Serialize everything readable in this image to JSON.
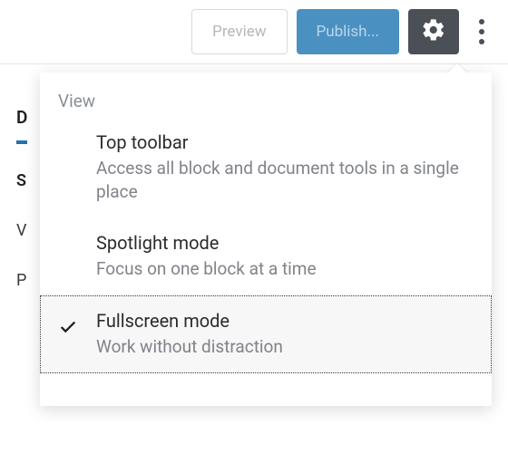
{
  "toolbar": {
    "preview_label": "Preview",
    "publish_label": "Publish...",
    "settings_icon": "gear",
    "more_icon": "kebab"
  },
  "background_panel": {
    "active_tab": "D",
    "section_label": "S",
    "rows": [
      "V",
      "P"
    ]
  },
  "menu": {
    "section_heading": "View",
    "items": [
      {
        "title": "Top toolbar",
        "description": "Access all block and document tools in a single place",
        "checked": false
      },
      {
        "title": "Spotlight mode",
        "description": "Focus on one block at a time",
        "checked": false
      },
      {
        "title": "Fullscreen mode",
        "description": "Work without distraction",
        "checked": true
      }
    ]
  }
}
